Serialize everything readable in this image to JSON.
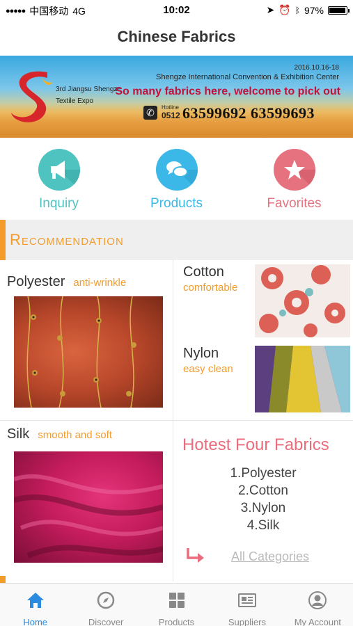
{
  "status_bar": {
    "carrier": "中国移动",
    "network": "4G",
    "time": "10:02",
    "battery": "97%",
    "battery_level": 0.97
  },
  "header": {
    "title": "Chinese Fabrics"
  },
  "banner": {
    "expo_line1": "3rd Jiangsu Shengze",
    "expo_line2": "Textile Expo",
    "date": "2016.10.16-18",
    "venue": "Shengze International Convention & Exhibition Center",
    "slogan": "So many fabrics here, welcome to pick out",
    "hotline_label": "Hotline",
    "area_code": "0512",
    "numbers": "63599692  63599693"
  },
  "quick_actions": [
    {
      "label": "Inquiry",
      "icon": "megaphone-icon",
      "color": "#4ec3c0"
    },
    {
      "label": "Products",
      "icon": "chat-bubbles-icon",
      "color": "#3cb8e8"
    },
    {
      "label": "Favorites",
      "icon": "star-icon",
      "color": "#e7727f"
    }
  ],
  "recommendation": {
    "title": "Recommendation",
    "accent": "#f39c2c",
    "items": [
      {
        "name": "Polyester",
        "tag": "anti-wrinkle"
      },
      {
        "name": "Cotton",
        "tag": "comfortable"
      },
      {
        "name": "Nylon",
        "tag": "easy clean"
      },
      {
        "name": "Silk",
        "tag": "smooth and soft"
      }
    ]
  },
  "hotest": {
    "title": "Hotest Four Fabrics",
    "list": [
      "1.Polyester",
      "2.Cotton",
      "3.Nylon",
      "4.Silk"
    ],
    "link": "All Categories"
  },
  "tabbar": {
    "items": [
      {
        "label": "Home",
        "icon": "home-icon",
        "active": true
      },
      {
        "label": "Discover",
        "icon": "compass-icon",
        "active": false
      },
      {
        "label": "Products",
        "icon": "grid-icon",
        "active": false
      },
      {
        "label": "Suppliers",
        "icon": "newspaper-icon",
        "active": false
      },
      {
        "label": "My Account",
        "icon": "user-icon",
        "active": false
      }
    ],
    "active_color": "#2a8be0"
  }
}
